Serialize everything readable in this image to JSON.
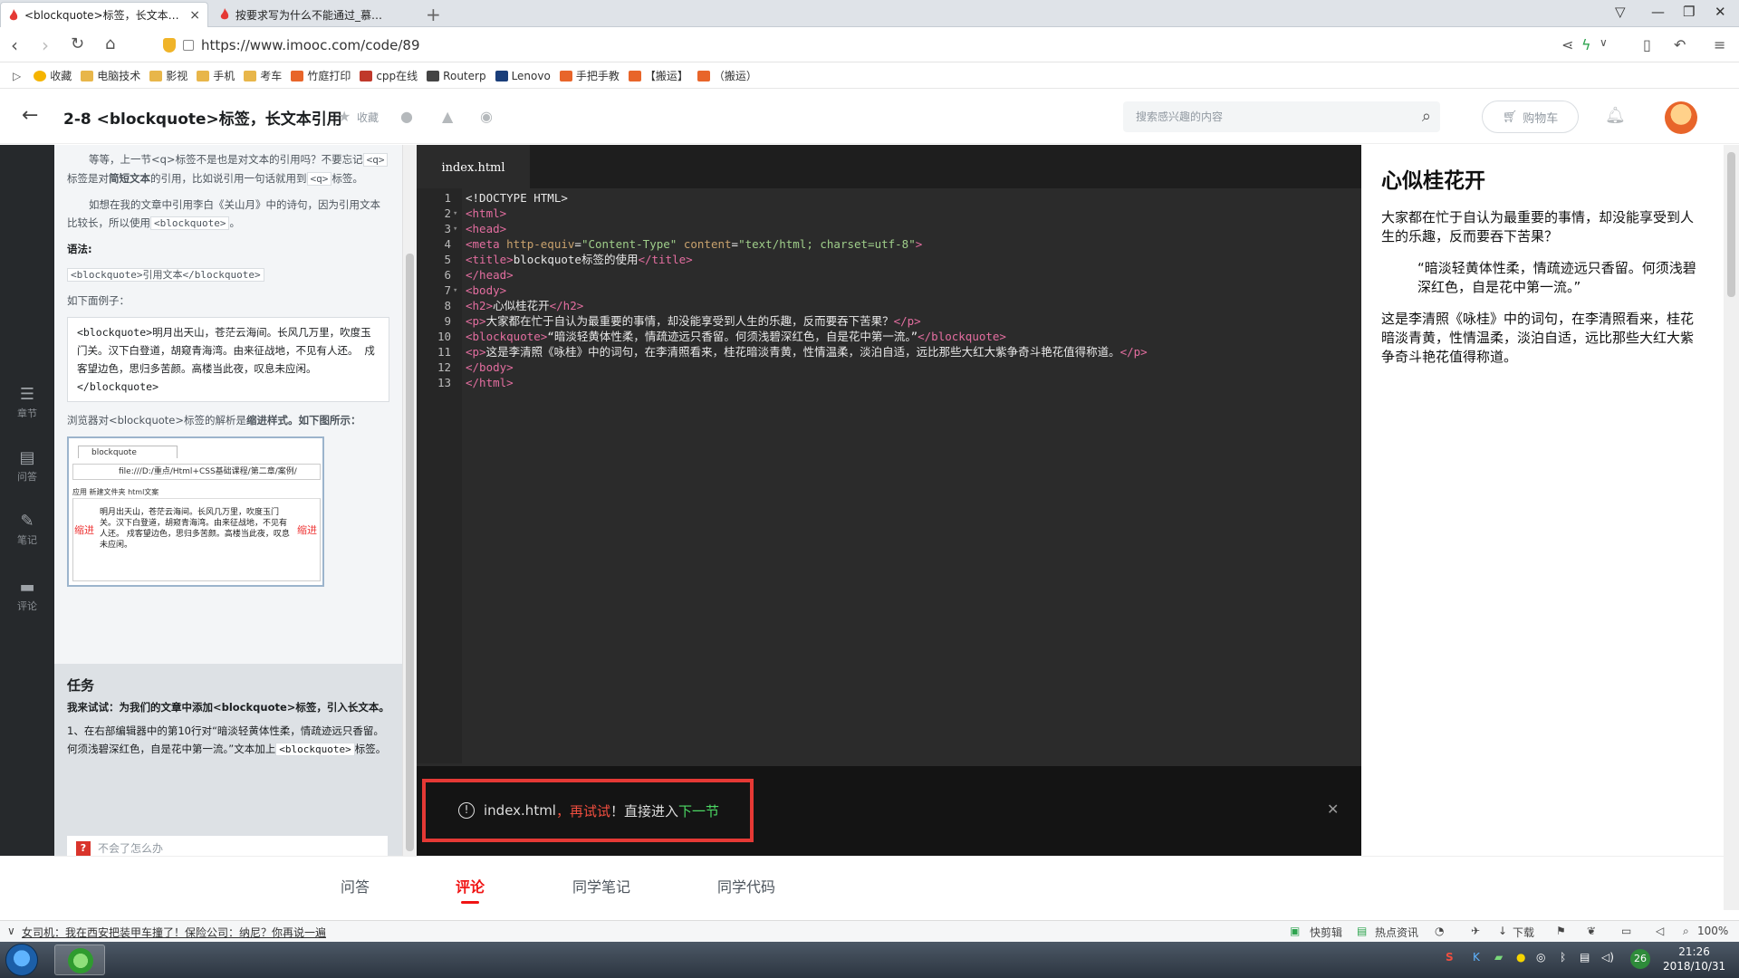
{
  "browser": {
    "tabs": [
      {
        "title": "<blockquote>标签，长文本引用",
        "close": "×"
      },
      {
        "title": "按要求写为什么不能通过_慕课问"
      }
    ],
    "new_tab": "+",
    "url": "https://www.imooc.com/code/89",
    "bookmarks": [
      {
        "label": "收藏",
        "color": "#f5b400"
      },
      {
        "label": "电脑技术",
        "color": "#e8b64a"
      },
      {
        "label": "影视",
        "color": "#e8b64a"
      },
      {
        "label": "手机",
        "color": "#e8b64a"
      },
      {
        "label": "考车",
        "color": "#e8b64a"
      },
      {
        "label": "竹庭打印",
        "color": "#e8652a"
      },
      {
        "label": "cpp在线",
        "color": "#c0392b"
      },
      {
        "label": "Routerp",
        "color": "#444444"
      },
      {
        "label": "Lenovo",
        "color": "#1a3e7a"
      },
      {
        "label": "手把手教",
        "color": "#e8652a"
      },
      {
        "label": "【搬运】",
        "color": "#e8652a"
      },
      {
        "label": "（搬运）",
        "color": "#e8652a"
      }
    ]
  },
  "header": {
    "title": "2-8 <blockquote>标签，长文本引用",
    "collect": "收藏",
    "search_placeholder": "搜索感兴趣的内容",
    "cart": "购物车"
  },
  "sidenav": [
    {
      "label": "章节",
      "icon": "chapter-icon"
    },
    {
      "label": "问答",
      "icon": "qa-icon"
    },
    {
      "label": "笔记",
      "icon": "note-icon"
    },
    {
      "label": "评论",
      "icon": "comment-icon"
    }
  ],
  "lesson": {
    "p1_a": "等等，上一节",
    "p1_code1": "<q>",
    "p1_b": "标签不是也是对文本的引用吗？不要忘记",
    "p1_code2": "<q>",
    "p1_c": "标签是对",
    "p1_bold": "简短文本",
    "p1_d": "的引用，比如说引用一句话就用到",
    "p1_code3": "<q>",
    "p1_e": "标签。",
    "p2_a": "如想在我的文章中引用李白《关山月》中的诗句，因为引用文本比较长，所以使用",
    "p2_code": "<blockquote>",
    "p2_b": "。",
    "syntax_label": "语法:",
    "syntax_code": "<blockquote>引用文本</blockquote>",
    "example_label": "如下面例子：",
    "example_code": "<blockquote>明月出天山，苍茫云海间。长风几万里，吹度玉门关。汉下白登道，胡窥青海湾。由来征战地，不见有人还。 戍客望边色，思归多苦颜。高楼当此夜，叹息未应闲。</blockquote>",
    "parse_text": "浏览器对<blockquote>标签的解析是",
    "parse_bold": "缩进样式。如下图所示：",
    "shot": {
      "tab": "blockquote",
      "url": "file:///D:/重点/Html+CSS基础课程/第二章/案例/",
      "bm": "应用  新建文件夹  html文案",
      "text": "明月出天山，苍茫云海间。长风几万里，吹度玉门关。汉下白登道，胡窥青海湾。由来征战地，不见有人还。 戍客望边色，思归多苦颜。高楼当此夜，叹息未应闲。",
      "indent": "缩进"
    }
  },
  "task": {
    "heading": "任务",
    "ask": "我来试试：为我们的文章中添加<blockquote>标签，引入长文本。",
    "step_a": "1、在右部编辑器中的第10行对",
    "step_b": "“暗淡轻黄体性柔，情疏迹远只香留。何须浅碧深红色，自是花中第一流。”",
    "step_c": "文本加上",
    "step_code": "<blockquote>",
    "step_d": "标签。",
    "help": "不会了怎么办"
  },
  "editor": {
    "tab": "index.html",
    "lines": [
      "1",
      "2",
      "3",
      "4",
      "5",
      "6",
      "7",
      "8",
      "9",
      "10",
      "11",
      "12",
      "13"
    ],
    "code": {
      "l1": "<!DOCTYPE HTML>",
      "l2": "<html>",
      "l3": "<head>",
      "l4_tag": "<meta ",
      "l4_attr1": "http-equiv",
      "l4_eq1": "=",
      "l4_val1": "\"Content-Type\"",
      "l4_attr2": " content",
      "l4_eq2": "=",
      "l4_val2": "\"text/html; charset=utf-8\"",
      "l4_end": ">",
      "l5_open": "<title>",
      "l5_text": "blockquote标签的使用",
      "l5_close": "</title>",
      "l6": "</head>",
      "l7": "<body>",
      "l8_open": "<h2>",
      "l8_text": "心似桂花开",
      "l8_close": "</h2>",
      "l9_open": "<p>",
      "l9_text": "大家都在忙于自认为最重要的事情，却没能享受到人生的乐趣，反而要吞下苦果？",
      "l9_close": "</p>",
      "l10_open": "<blockquote>",
      "l10_text": "“暗淡轻黄体性柔，情疏迹远只香留。何须浅碧深红色，自是花中第一流。”",
      "l10_close": "</blockquote>",
      "l11_open": "<p>",
      "l11_text": "这是李清照《咏桂》中的词句，在李清照看来，桂花暗淡青黄，性情温柔，淡泊自适，远比那些大红大紫争奇斗艳花值得称道。",
      "l11_close": "</p>",
      "l12": "</body>",
      "l13": "</html>"
    },
    "console": {
      "file": "index.html",
      "comma": "，",
      "retry": "再试试",
      "mid": "！直接进入",
      "next": "下一节"
    }
  },
  "preview": {
    "h2": "心似桂花开",
    "p1": "大家都在忙于自认为最重要的事情，却没能享受到人生的乐趣，反而要吞下苦果？",
    "quote": "“暗淡轻黄体性柔，情疏迹远只香留。何须浅碧深红色，自是花中第一流。”",
    "p2": "这是李清照《咏桂》中的词句，在李清照看来，桂花暗淡青黄，性情温柔，淡泊自适，远比那些大红大紫争奇斗艳花值得称道。"
  },
  "bottom_tabs": [
    "问答",
    "评论",
    "同学笔记",
    "同学代码"
  ],
  "statusbar": {
    "news": "女司机：我在西安把装甲车撞了！保险公司：纳尼？你再说一遍",
    "items": [
      "快剪辑",
      "热点资讯",
      "下载",
      "100%"
    ]
  },
  "taskbar": {
    "clock_time": "21:26",
    "clock_date": "2018/10/31",
    "badge": "26"
  }
}
